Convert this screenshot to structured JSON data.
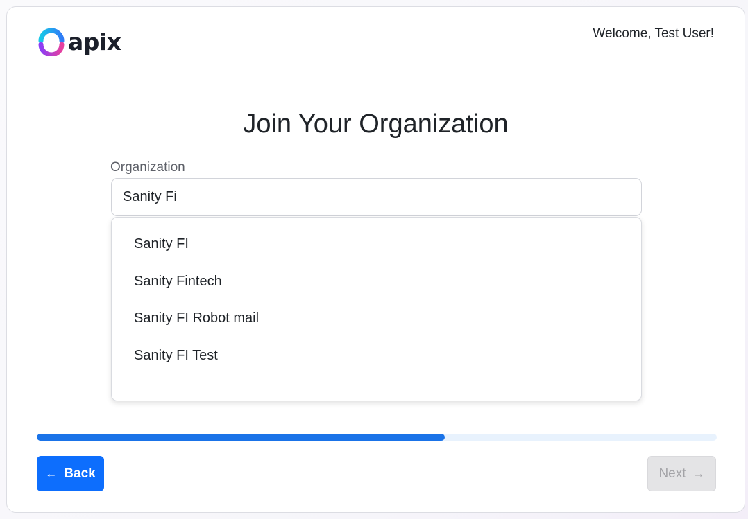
{
  "header": {
    "logo_text": "apix",
    "welcome_text": "Welcome, Test User!"
  },
  "page": {
    "title": "Join Your Organization"
  },
  "organization": {
    "label": "Organization",
    "value": "Sanity Fi",
    "suggestions": [
      "Sanity FI",
      "Sanity Fintech",
      "Sanity FI Robot mail",
      "Sanity FI Test"
    ]
  },
  "progress": {
    "fraction": 0.6
  },
  "footer": {
    "back_label": "Back",
    "next_label": "Next",
    "back_icon": "arrow-left-icon",
    "next_icon": "arrow-right-icon"
  },
  "colors": {
    "primary": "#0d6efd",
    "progress_fill": "#1a73e8",
    "progress_track": "#e8f2fd",
    "disabled_bg": "#e4e4e6",
    "logo_gradient": [
      "#18c7e8",
      "#2f7cf6",
      "#8b3df5",
      "#e7409e"
    ]
  }
}
